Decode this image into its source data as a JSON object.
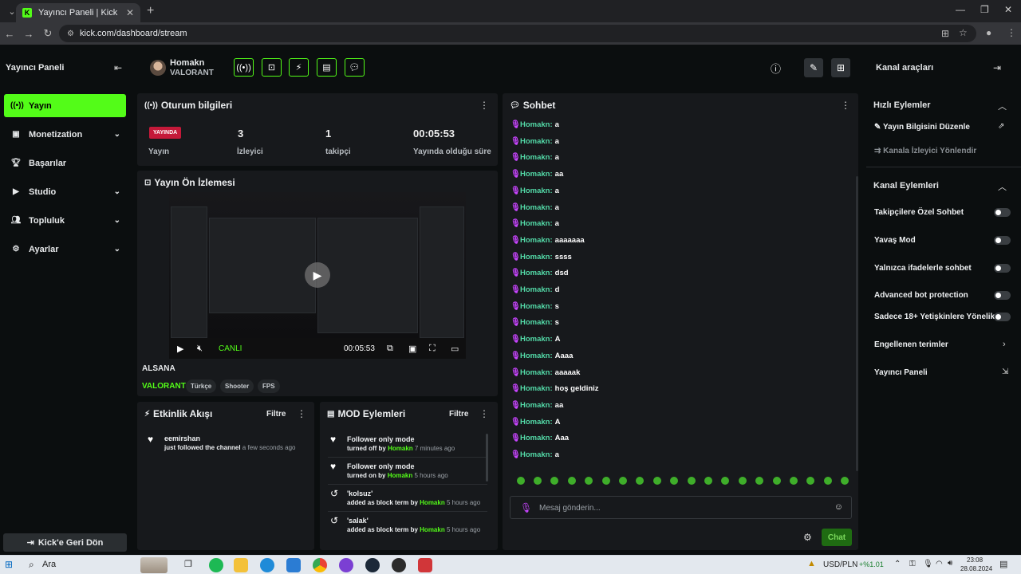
{
  "browser": {
    "tab_title": "Yayıncı Paneli | Kick",
    "tab_favicon": "K",
    "url": "kick.com/dashboard/stream"
  },
  "sidebar": {
    "title": "Yayıncı Paneli",
    "items": [
      {
        "label": "Yayın",
        "icon": "broadcast-icon",
        "active": true
      },
      {
        "label": "Monetization",
        "icon": "money-icon",
        "chevron": true
      },
      {
        "label": "Başarılar",
        "icon": "trophy-icon"
      },
      {
        "label": "Studio",
        "icon": "studio-icon",
        "chevron": true
      },
      {
        "label": "Topluluk",
        "icon": "people-icon",
        "chevron": true
      },
      {
        "label": "Ayarlar",
        "icon": "gear-icon",
        "chevron": true
      }
    ],
    "back_label": "Kick'e Geri Dön"
  },
  "header": {
    "username": "Homakn",
    "category": "VALORANT"
  },
  "session": {
    "title": "Oturum bilgileri",
    "live_badge": "YAYINDA",
    "live_label": "Yayın",
    "viewers_value": "3",
    "viewers_label": "İzleyici",
    "followers_value": "1",
    "followers_label": "takipçi",
    "uptime_value": "00:05:53",
    "uptime_label": "Yayında olduğu süre"
  },
  "preview": {
    "title": "Yayın Ön İzlemesi",
    "live_text": "CANLI",
    "time": "00:05:53",
    "stream_title": "ALSANA",
    "game": "VALORANT",
    "tags": [
      "Türkçe",
      "Shooter",
      "FPS"
    ]
  },
  "activity": {
    "title": "Etkinlik Akışı",
    "filter": "Filtre",
    "items": [
      {
        "user": "eemirshan",
        "text": "just followed the channel",
        "time": "a few seconds ago"
      }
    ]
  },
  "mod": {
    "title": "MOD Eylemleri",
    "filter": "Filtre",
    "items": [
      {
        "title": "Follower only mode",
        "action": "turned off by",
        "user": "Homakn",
        "time": "7 minutes ago"
      },
      {
        "title": "Follower only mode",
        "action": "turned on by",
        "user": "Homakn",
        "time": "5 hours ago"
      },
      {
        "title": "'kolsuz'",
        "action": "added as block term by",
        "user": "Homakn",
        "time": "5 hours ago"
      },
      {
        "title": "'salak'",
        "action": "added as block term by",
        "user": "Homakn",
        "time": "5 hours ago"
      }
    ]
  },
  "chat": {
    "title": "Sohbet",
    "messages": [
      {
        "user": "Homakn:",
        "text": "a"
      },
      {
        "user": "Homakn:",
        "text": "a"
      },
      {
        "user": "Homakn:",
        "text": "a"
      },
      {
        "user": "Homakn:",
        "text": "aa"
      },
      {
        "user": "Homakn:",
        "text": "a"
      },
      {
        "user": "Homakn:",
        "text": "a"
      },
      {
        "user": "Homakn:",
        "text": "a"
      },
      {
        "user": "Homakn:",
        "text": "aaaaaaa"
      },
      {
        "user": "Homakn:",
        "text": "ssss"
      },
      {
        "user": "Homakn:",
        "text": "dsd"
      },
      {
        "user": "Homakn:",
        "text": "d"
      },
      {
        "user": "Homakn:",
        "text": "s"
      },
      {
        "user": "Homakn:",
        "text": "s"
      },
      {
        "user": "Homakn:",
        "text": "A"
      },
      {
        "user": "Homakn:",
        "text": "Aaaa"
      },
      {
        "user": "Homakn:",
        "text": "aaaaak"
      },
      {
        "user": "Homakn:",
        "text": "hoş geldiniz"
      },
      {
        "user": "Homakn:",
        "text": "aa"
      },
      {
        "user": "Homakn:",
        "text": "A"
      },
      {
        "user": "Homakn:",
        "text": "Aaa"
      },
      {
        "user": "Homakn:",
        "text": "a"
      }
    ],
    "placeholder": "Mesaj gönderin...",
    "send_label": "Chat"
  },
  "right_panel": {
    "title": "Kanal araçları",
    "quick_title": "Hızlı Eylemler",
    "quick_items": [
      "Yayın Bilgisini Düzenle",
      "Kanala İzleyici Yönlendir"
    ],
    "channel_title": "Kanal Eylemleri",
    "toggles": [
      "Takipçilere Özel Sohbet",
      "Yavaş Mod",
      "Yalnızca ifadelerle sohbet",
      "Advanced bot protection",
      "Sadece 18+ Yetişkinlere Yönelik"
    ],
    "links": [
      "Engellenen terimler",
      "Yayıncı Paneli"
    ]
  },
  "taskbar": {
    "search": "Ara",
    "currency": "USD/PLN",
    "change": "+%1.01",
    "time": "23:08",
    "date": "28.08.2024"
  },
  "colors": {
    "accent": "#53fc18",
    "live": "#c41939",
    "username": "#53d9a7",
    "mic": "#c844ff"
  }
}
